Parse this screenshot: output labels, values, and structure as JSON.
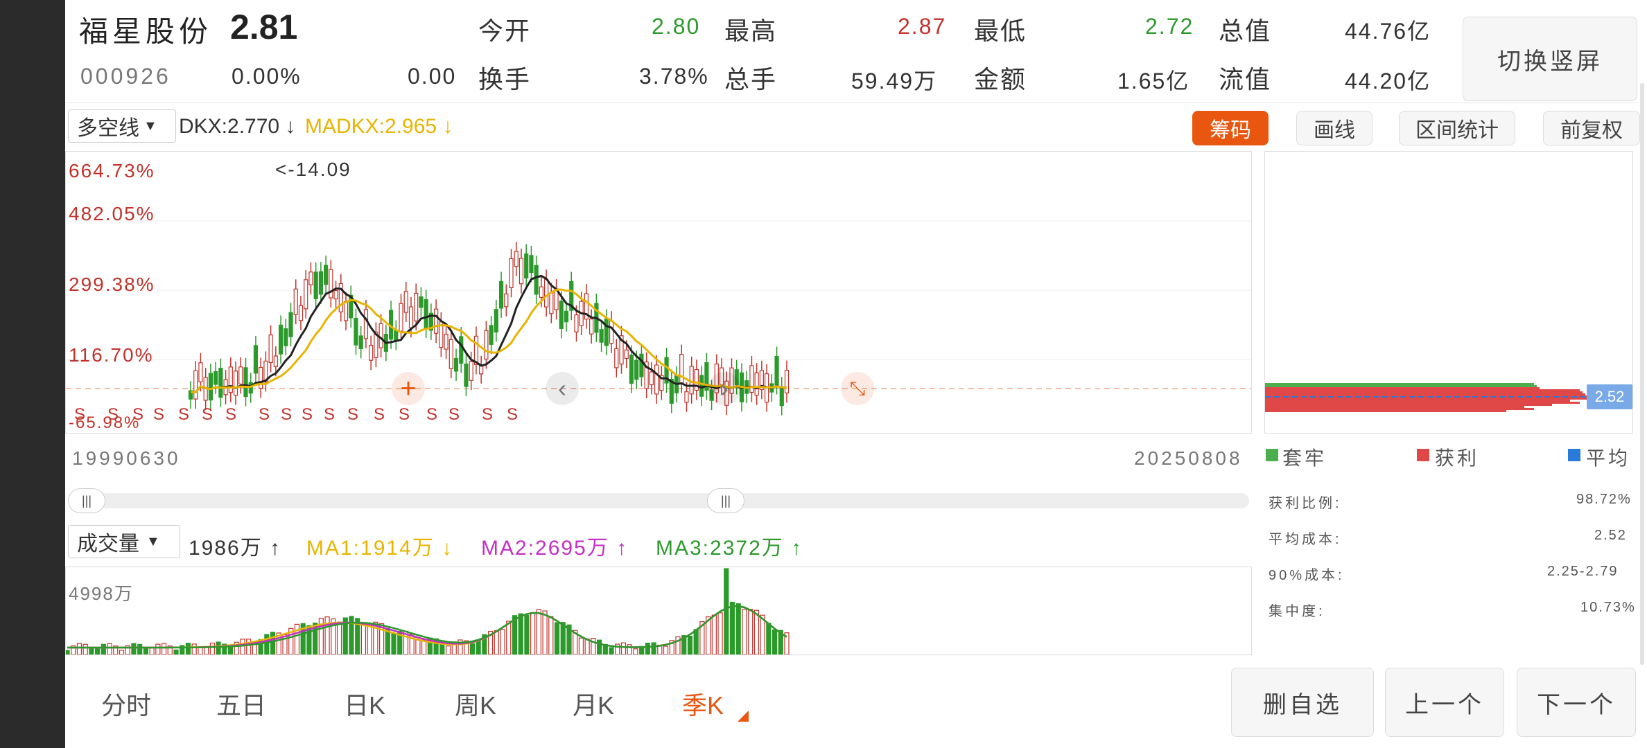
{
  "stock": {
    "name": "福星股份",
    "price": "2.81",
    "code": "000926",
    "change_pct": "0.00%",
    "change": "0.00"
  },
  "quote": {
    "open_label": "今开",
    "open": "2.80",
    "high_label": "最高",
    "high": "2.87",
    "low_label": "最低",
    "low": "2.72",
    "mktcap_label": "总值",
    "mktcap": "44.76亿",
    "turnover_label": "换手",
    "turnover": "3.78%",
    "volume_label": "总手",
    "volume": "59.49万",
    "amount_label": "金额",
    "amount": "1.65亿",
    "float_label": "流值",
    "float_cap": "44.20亿"
  },
  "switch_label": "切换竖屏",
  "indicator": {
    "select": "多空线",
    "dkx": "DKX:2.770 ↓",
    "madkx": "MADKX:2.965 ↓"
  },
  "tools": {
    "chip": "筹码",
    "draw": "画线",
    "range": "区间统计",
    "adjust": "前复权"
  },
  "price_axis": {
    "labels": [
      "664.73%",
      "482.05%",
      "299.38%",
      "116.70%",
      "-65.98%"
    ],
    "peak_note": "<-14.09",
    "marker": "S"
  },
  "date_range": {
    "start": "19990630",
    "end": "20250808"
  },
  "volume_panel": {
    "select": "成交量",
    "vol": "1986万 ↑",
    "ma1": "MA1:1914万 ↓",
    "ma2": "MA2:2695万 ↑",
    "ma3": "MA3:2372万 ↑",
    "max_label": "4998万"
  },
  "chip_panel": {
    "price_tag": "2.52",
    "legend": {
      "trapped": "套牢",
      "profit": "获利",
      "avg": "平均"
    },
    "stats": [
      {
        "label": "获利比例:",
        "value": "98.72%"
      },
      {
        "label": "平均成本:",
        "value": "2.52"
      },
      {
        "label": "90%成本:",
        "value": "2.25-2.79"
      },
      {
        "label": "集中度:",
        "value": "10.73%"
      }
    ]
  },
  "period_tabs": [
    "分时",
    "五日",
    "日K",
    "周K",
    "月K",
    "季K"
  ],
  "active_tab": "季K",
  "bottom_buttons": {
    "remove": "删自选",
    "prev": "上一个",
    "next": "下一个"
  },
  "colors": {
    "up": "#c2322b",
    "down": "#2b9a2b",
    "accent": "#e8560f",
    "ma_yellow": "#e8b400",
    "ma_magenta": "#c42fc4",
    "dkx": "#222222"
  }
}
